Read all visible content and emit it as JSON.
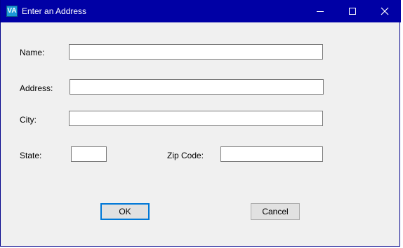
{
  "window": {
    "title": "Enter an Address",
    "icon": "va-app-icon",
    "icon_text": "VA",
    "controls": [
      "minimize-icon",
      "maximize-icon",
      "close-icon"
    ],
    "title_bar_color": "#0000a5"
  },
  "form": {
    "name": {
      "label": "Name:",
      "value": ""
    },
    "address": {
      "label": "Address:",
      "value": ""
    },
    "city": {
      "label": "City:",
      "value": ""
    },
    "state": {
      "label": "State:",
      "value": ""
    },
    "zip": {
      "label": "Zip Code:",
      "value": ""
    }
  },
  "buttons": {
    "ok": "OK",
    "cancel": "Cancel"
  },
  "colors": {
    "default_button_border": "#0078d7",
    "window_background": "#f0f0f0"
  }
}
